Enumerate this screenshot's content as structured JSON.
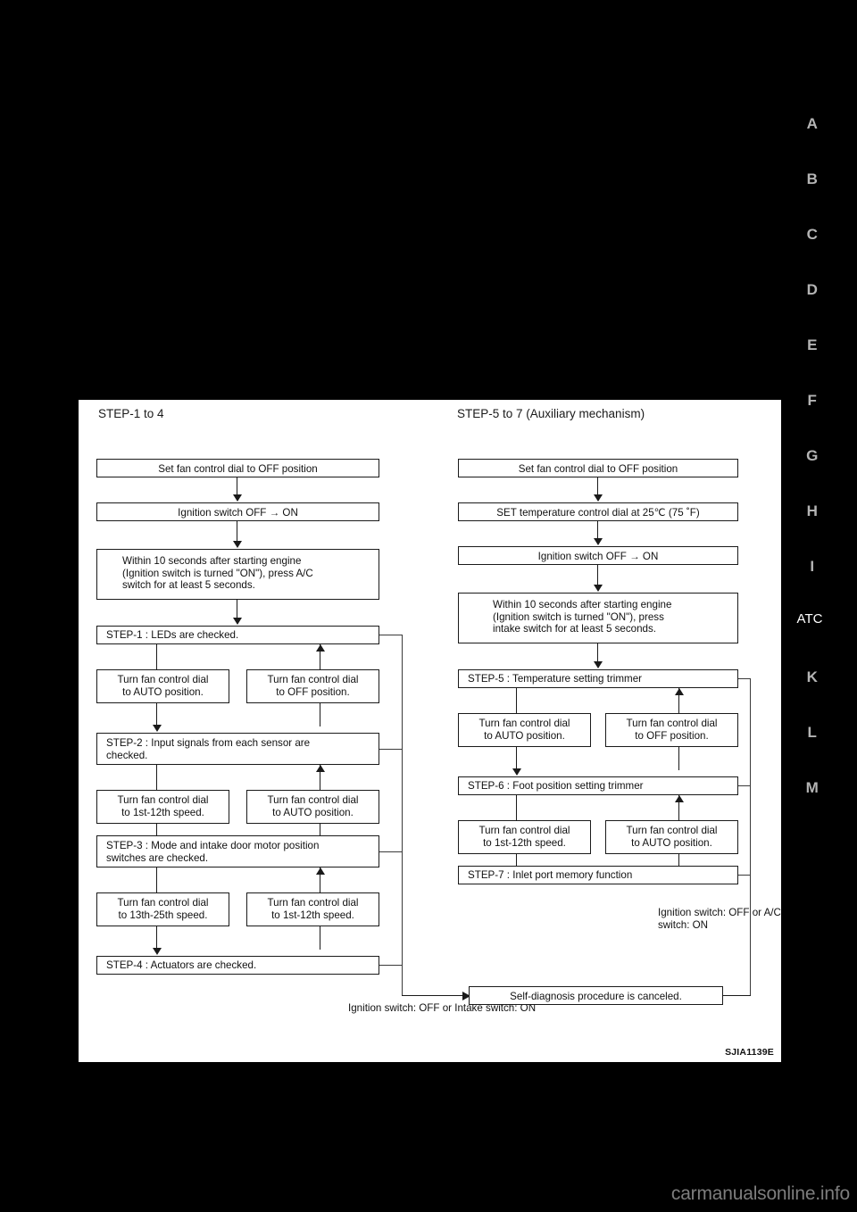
{
  "page": {
    "background_color": "#000000",
    "figure_id": "SJIA1139E",
    "watermark": "carmanualsonline.info"
  },
  "section_tabs": {
    "items": [
      {
        "label": "A",
        "active": false
      },
      {
        "label": "B",
        "active": false
      },
      {
        "label": "C",
        "active": false
      },
      {
        "label": "D",
        "active": false
      },
      {
        "label": "E",
        "active": false
      },
      {
        "label": "F",
        "active": false
      },
      {
        "label": "G",
        "active": false
      },
      {
        "label": "H",
        "active": false
      },
      {
        "label": "I",
        "active": false
      },
      {
        "label": "ATC",
        "active": true
      },
      {
        "label": "K",
        "active": false
      },
      {
        "label": "L",
        "active": false
      },
      {
        "label": "M",
        "active": false
      }
    ],
    "active_color": "#ffffff",
    "inactive_color": "#b4b4b4"
  },
  "figure": {
    "left_column": {
      "title": "STEP-1 to 4",
      "boxes": {
        "set_fan": "Set fan control dial to OFF position",
        "ignition": "Ignition switch OFF  →  ON",
        "within10_l1": "Within 10 seconds after starting engine",
        "within10_l2": "(Ignition switch is turned \"ON\"), press A/C",
        "within10_l3": "switch for at least 5 seconds.",
        "step1": "STEP-1 : LEDs are checked.",
        "t1_left_l1": "Turn fan control dial",
        "t1_left_l2": "to AUTO position.",
        "t1_right_l1": "Turn fan control dial",
        "t1_right_l2": "to OFF position.",
        "step2_l1": "STEP-2 : Input signals from each sensor are",
        "step2_l2": "checked.",
        "t2_left_l1": "Turn fan control dial",
        "t2_left_l2": "to 1st-12th speed.",
        "t2_right_l1": "Turn fan control dial",
        "t2_right_l2": "to AUTO position.",
        "step3_l1": "STEP-3 : Mode and intake door motor position",
        "step3_l2": "switches are checked.",
        "t3_left_l1": "Turn fan control dial",
        "t3_left_l2": "to 13th-25th speed.",
        "t3_right_l1": "Turn fan control dial",
        "t3_right_l2": "to 1st-12th speed.",
        "step4": "STEP-4 : Actuators are checked."
      },
      "cancel_note_l1": "Ignition switch: OFF",
      "cancel_note_l2": "or Intake switch: ON"
    },
    "right_column": {
      "title": "STEP-5 to 7 (Auxiliary mechanism)",
      "boxes": {
        "set_fan": "Set fan control dial to OFF position",
        "set_temp": "SET temperature control dial at 25℃ (75 ˚F)",
        "ignition": "Ignition switch OFF  →  ON",
        "within10_l1": "Within 10 seconds after starting engine",
        "within10_l2": "(Ignition switch is turned \"ON\"), press",
        "within10_l3": "intake switch for at least 5 seconds.",
        "step5": "STEP-5 : Temperature setting trimmer",
        "t5_left_l1": "Turn fan control dial",
        "t5_left_l2": "to AUTO position.",
        "t5_right_l1": "Turn fan control dial",
        "t5_right_l2": "to OFF position.",
        "step6": "STEP-6 : Foot position setting trimmer",
        "t6_left_l1": "Turn fan control dial",
        "t6_left_l2": "to 1st-12th speed.",
        "t6_right_l1": "Turn fan control dial",
        "t6_right_l2": "to AUTO position.",
        "step7": "STEP-7 : Inlet port memory function"
      },
      "cancel_note_l1": "Ignition switch: OFF",
      "cancel_note_l2": "or A/C switch: ON"
    },
    "shared": {
      "self_diagnosis": "Self-diagnosis procedure is canceled."
    }
  }
}
